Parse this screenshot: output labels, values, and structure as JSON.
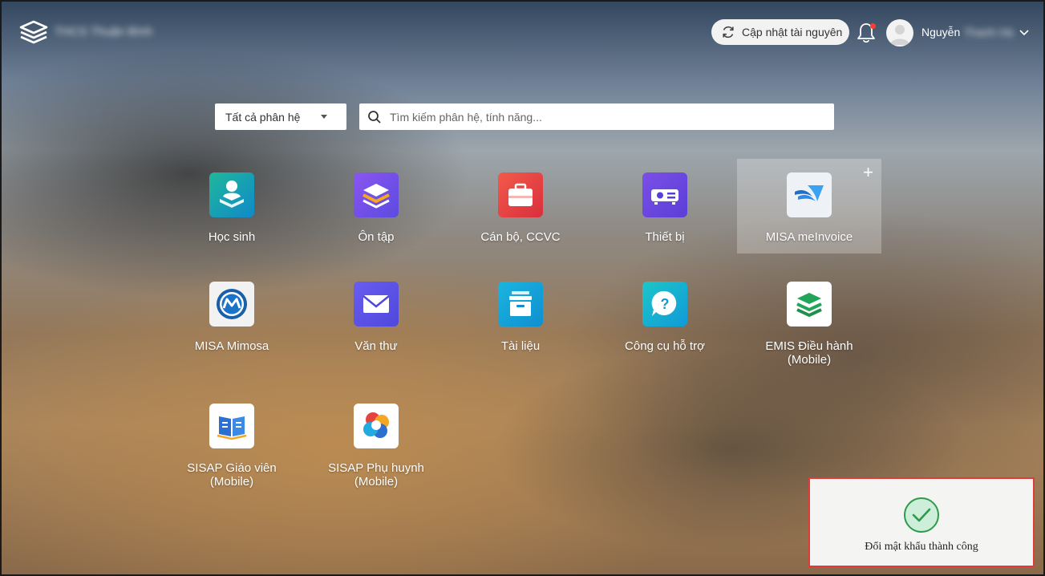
{
  "header": {
    "org_name": "THCS Thuận Bình",
    "update_button": "Cập nhật tài nguyên",
    "user_name": "Nguyễn",
    "user_name_rest": "Thanh Hà"
  },
  "search": {
    "select_value": "Tất cả phân hệ",
    "placeholder": "Tìm kiếm phân hệ, tính năng..."
  },
  "apps": [
    {
      "label": "Học sinh"
    },
    {
      "label": "Ôn tập"
    },
    {
      "label": "Cán bộ, CCVC"
    },
    {
      "label": "Thiết bị"
    },
    {
      "label": "MISA meInvoice"
    },
    {
      "label": "MISA Mimosa"
    },
    {
      "label": "Văn thư"
    },
    {
      "label": "Tài liệu"
    },
    {
      "label": "Công cụ hỗ trợ"
    },
    {
      "label": "EMIS Điều hành (Mobile)"
    },
    {
      "label": "SISAP Giáo viên (Mobile)"
    },
    {
      "label": "SISAP Phụ huynh (Mobile)"
    }
  ],
  "toast": {
    "message": "Đổi mật khẩu thành công"
  },
  "colors": {
    "toast_border": "#e03a3a",
    "notification_dot": "#ff3b30",
    "success": "#2e9a4e"
  }
}
